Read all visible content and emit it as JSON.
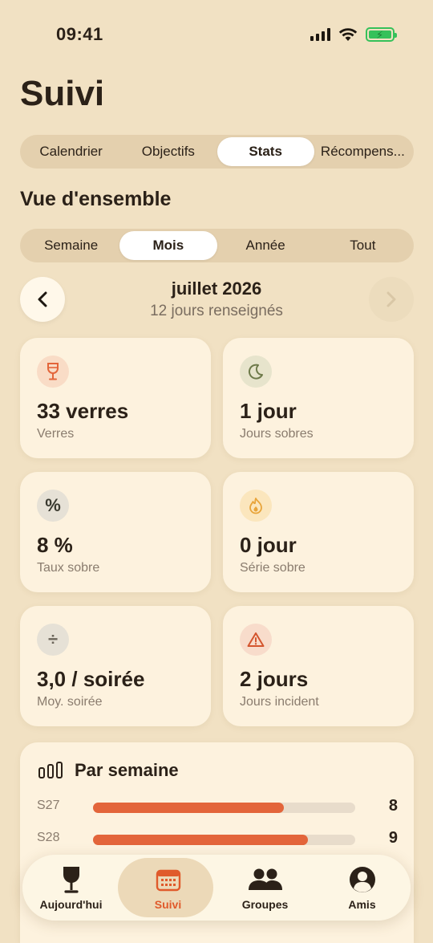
{
  "status": {
    "time": "09:41"
  },
  "page_title": "Suivi",
  "main_tabs": [
    {
      "label": "Calendrier",
      "active": false
    },
    {
      "label": "Objectifs",
      "active": false
    },
    {
      "label": "Stats",
      "active": true
    },
    {
      "label": "Récompens...",
      "active": false
    }
  ],
  "section_title": "Vue d'ensemble",
  "period_tabs": [
    {
      "label": "Semaine",
      "active": false
    },
    {
      "label": "Mois",
      "active": true
    },
    {
      "label": "Année",
      "active": false
    },
    {
      "label": "Tout",
      "active": false
    }
  ],
  "month": {
    "title": "juillet 2026",
    "subtitle": "12 jours renseignés"
  },
  "stats": [
    {
      "value": "33 verres",
      "label": "Verres",
      "icon": "wine-glass-icon",
      "color": "#e3653a"
    },
    {
      "value": "1 jour",
      "label": "Jours sobres",
      "icon": "moon-icon",
      "color": "#6e7a4a"
    },
    {
      "value": "8 %",
      "label": "Taux sobre",
      "icon": "percent-icon",
      "color": "#4e4a40"
    },
    {
      "value": "0 jour",
      "label": "Série sobre",
      "icon": "flame-icon",
      "color": "#e8a43a"
    },
    {
      "value": "3,0 / soirée",
      "label": "Moy. soirée",
      "icon": "divide-icon",
      "color": "#6b655a"
    },
    {
      "value": "2 jours",
      "label": "Jours incident",
      "icon": "warning-icon",
      "color": "#d4552e"
    }
  ],
  "weekly": {
    "title": "Par semaine",
    "max": 11,
    "rows": [
      {
        "label": "S27",
        "value": 8
      },
      {
        "label": "S28",
        "value": 9
      }
    ]
  },
  "tabbar": [
    {
      "label": "Aujourd'hui",
      "icon": "wine-glass-icon",
      "active": false
    },
    {
      "label": "Suivi",
      "icon": "calendar-icon",
      "active": true
    },
    {
      "label": "Groupes",
      "icon": "group-icon",
      "active": false
    },
    {
      "label": "Amis",
      "icon": "person-icon",
      "active": false
    }
  ],
  "colors": {
    "accent": "#e05a2b",
    "background": "#f1e1c3",
    "card": "#fdf2de"
  }
}
